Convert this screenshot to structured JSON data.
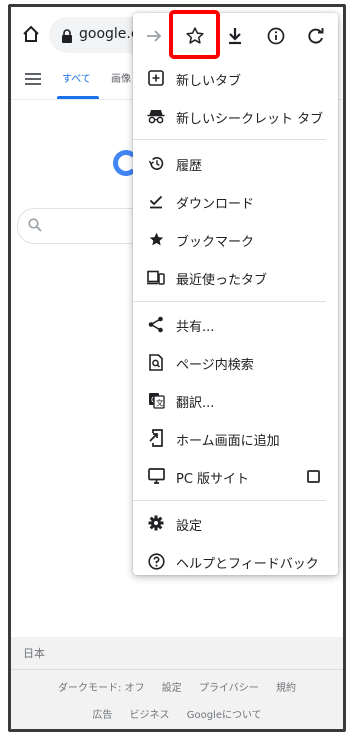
{
  "browser": {
    "url": "google.co"
  },
  "page": {
    "tabs": [
      "すべて",
      "画像"
    ],
    "country": "日本",
    "footer_links_row1": [
      "ダークモード: オフ",
      "設定",
      "プライバシー",
      "規約"
    ],
    "footer_links_row2": [
      "広告",
      "ビジネス",
      "Googleについて"
    ]
  },
  "menu": {
    "toolbar": [
      "forward-arrow-icon",
      "bookmark-star-icon",
      "download-icon",
      "info-icon",
      "refresh-icon"
    ],
    "items": [
      {
        "label": "新しいタブ",
        "icon": "new-tab-icon"
      },
      {
        "label": "新しいシークレット タブ",
        "icon": "incognito-icon"
      },
      {
        "label": "履歴",
        "icon": "history-icon"
      },
      {
        "label": "ダウンロード",
        "icon": "downloads-icon"
      },
      {
        "label": "ブックマーク",
        "icon": "bookmarks-star-icon"
      },
      {
        "label": "最近使ったタブ",
        "icon": "recent-tabs-icon"
      },
      {
        "label": "共有...",
        "icon": "share-icon"
      },
      {
        "label": "ページ内検索",
        "icon": "find-in-page-icon"
      },
      {
        "label": "翻訳...",
        "icon": "translate-icon"
      },
      {
        "label": "ホーム画面に追加",
        "icon": "add-to-home-icon"
      },
      {
        "label": "PC 版サイト",
        "icon": "desktop-site-icon",
        "checked": false
      },
      {
        "label": "設定",
        "icon": "settings-gear-icon"
      },
      {
        "label": "ヘルプとフィードバック",
        "icon": "help-icon"
      }
    ]
  },
  "colors": {
    "highlight": "#ff0000",
    "accent": "#1a73e8"
  }
}
